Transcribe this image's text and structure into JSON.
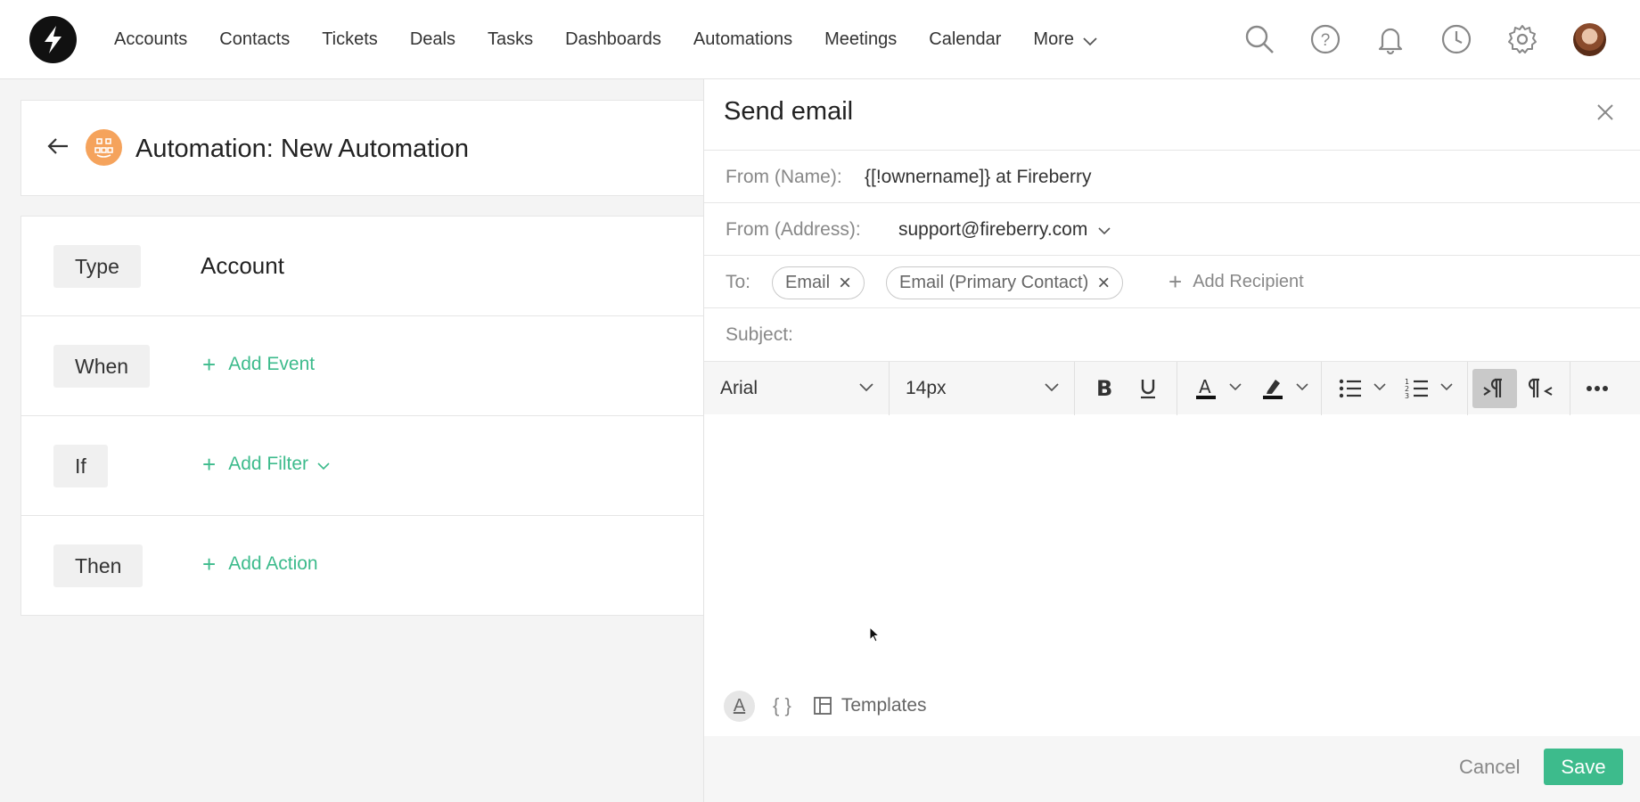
{
  "nav": {
    "items": [
      "Accounts",
      "Contacts",
      "Tickets",
      "Deals",
      "Tasks",
      "Dashboards",
      "Automations",
      "Meetings",
      "Calendar"
    ],
    "more_label": "More",
    "icons": [
      "search-icon",
      "help-icon",
      "bell-icon",
      "clock-icon",
      "gear-icon"
    ]
  },
  "automation": {
    "title": "Automation: New Automation",
    "rows": {
      "type_label": "Type",
      "type_value": "Account",
      "when_label": "When",
      "when_action": "Add Event",
      "if_label": "If",
      "if_action": "Add Filter",
      "then_label": "Then",
      "then_action": "Add Action"
    }
  },
  "email_panel": {
    "title": "Send email",
    "from_name_label": "From (Name):",
    "from_name_value": "{[!ownername]} at Fireberry",
    "from_address_label": "From (Address):",
    "from_address_value": "support@fireberry.com",
    "to_label": "To:",
    "recipients": [
      "Email",
      "Email (Primary Contact)"
    ],
    "add_recipient": "Add Recipient",
    "subject_label": "Subject:",
    "subject_value": "",
    "toolbar": {
      "font": "Arial",
      "size": "14px"
    },
    "templates_label": "Templates",
    "braces_label": "{ }",
    "text_format_label": "A",
    "cancel_label": "Cancel",
    "save_label": "Save"
  },
  "colors": {
    "accent": "#3dbb8c",
    "automation_icon": "#f5a35c"
  }
}
